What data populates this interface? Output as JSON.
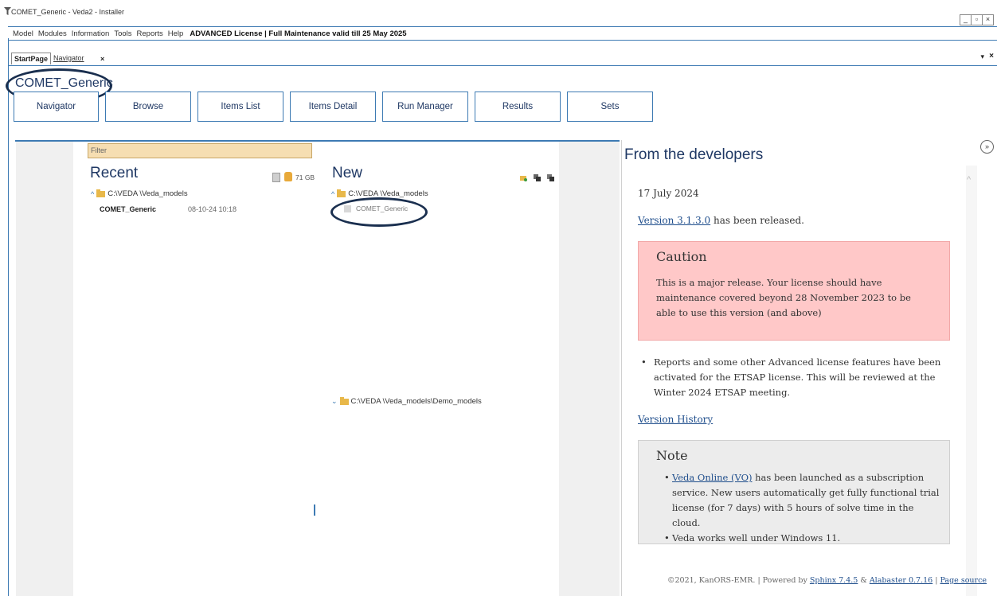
{
  "window": {
    "title": "COMET_Generic - Veda2 - Installer"
  },
  "menu": {
    "items": [
      "Model",
      "Modules",
      "Information",
      "Tools",
      "Reports",
      "Help"
    ],
    "license": "ADVANCED License | Full Maintenance valid till 25 May 2025"
  },
  "tabs": {
    "active": "StartPage",
    "other": "Navigator",
    "close": "×",
    "menu": "▾",
    "panel_close": "×"
  },
  "model": {
    "title": "COMET_Generic"
  },
  "buttons": [
    "Navigator",
    "Browse",
    "Items List",
    "Items Detail",
    "Run Manager",
    "Results",
    "Sets"
  ],
  "filter": {
    "placeholder": "Filter"
  },
  "recent": {
    "heading": "Recent",
    "path": "C:\\VEDA  \\Veda_models",
    "disk": "71 GB",
    "item": {
      "name": "COMET_Generic",
      "date": "08-10-24 10:18"
    }
  },
  "new": {
    "heading": "New",
    "path": "C:\\VEDA  \\Veda_models",
    "item": "COMET_Generic",
    "demo_path": "C:\\VEDA  \\Veda_models\\Demo_models"
  },
  "developers": {
    "title": "From the developers",
    "date": "17 July 2024",
    "version_link": "Version 3.1.3.0",
    "version_suffix": " has been released.",
    "caution_title": "Caution",
    "caution_body": "This is a major release. Your license should have maintenance covered beyond 28 November 2023 to be able to use this version (and above)",
    "bullet": "Reports and some other Advanced license features have been activated for the ETSAP license. This will be reviewed at the Winter 2024 ETSAP meeting.",
    "history_link": "Version History",
    "note_title": "Note",
    "note_link": "Veda Online (VO)",
    "note_item1_rest": " has been launched as a subscription service. New users automatically get fully functional trial license (for 7 days) with 5 hours of solve time in the cloud.",
    "note_item2": "Veda works well under Windows 11.",
    "footer_prefix": "©2021, KanORS-EMR. | Powered by ",
    "footer_sphinx": "Sphinx 7.4.5",
    "footer_amp": " & ",
    "footer_alabaster": "Alabaster 0.7.16",
    "footer_sep": " | ",
    "footer_source": "Page source"
  },
  "colors": {
    "accent": "#3d7ab3",
    "title": "#1f3864",
    "filter_bg": "#f6deb2",
    "caution_bg": "#ffc8c8",
    "note_bg": "#ececec"
  }
}
